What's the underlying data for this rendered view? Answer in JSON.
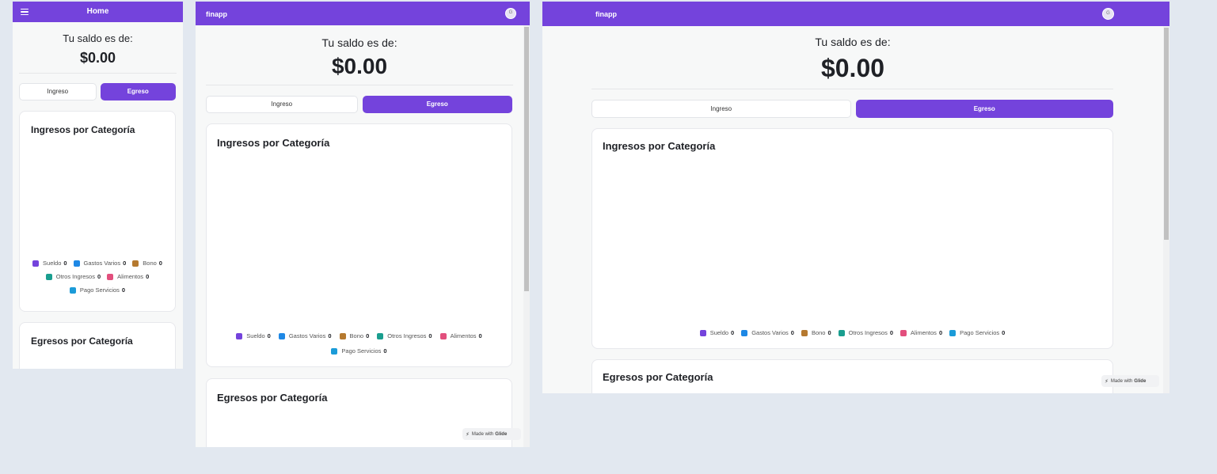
{
  "colors": {
    "accent": "#7443dc",
    "legend": [
      "#7443dc",
      "#1e88e5",
      "#b5792f",
      "#1a9e8f",
      "#e24f7d",
      "#1b9bd8"
    ]
  },
  "views": [
    {
      "header_title": "Home",
      "menu_icon": "hamburger-icon",
      "balance_label": "Tu saldo es de:",
      "balance_value": "$0.00",
      "segment": {
        "ingreso": "Ingreso",
        "egreso": "Egreso",
        "selected": "Egreso"
      },
      "card1_title": "Ingresos por Categoría",
      "card2_title": "Egresos por Categoría",
      "legend": [
        {
          "label": "Sueldo",
          "value": "0"
        },
        {
          "label": "Gastos Varios",
          "value": "0"
        },
        {
          "label": "Bono",
          "value": "0"
        },
        {
          "label": "Otros Ingresos",
          "value": "0"
        },
        {
          "label": "Alimentos",
          "value": "0"
        },
        {
          "label": "Pago Servicios",
          "value": "0"
        }
      ]
    },
    {
      "header_title": "finapp",
      "avatar_initial": "G",
      "balance_label": "Tu saldo es de:",
      "balance_value": "$0.00",
      "segment": {
        "ingreso": "Ingreso",
        "egreso": "Egreso",
        "selected": "Egreso"
      },
      "card1_title": "Ingresos por Categoría",
      "card2_title": "Egresos por Categoría",
      "legend": [
        {
          "label": "Sueldo",
          "value": "0"
        },
        {
          "label": "Gastos Varios",
          "value": "0"
        },
        {
          "label": "Bono",
          "value": "0"
        },
        {
          "label": "Otros Ingresos",
          "value": "0"
        },
        {
          "label": "Alimentos",
          "value": "0"
        },
        {
          "label": "Pago Servicios",
          "value": "0"
        }
      ],
      "badge": {
        "prefix": "Made with",
        "brand": "Glide"
      }
    },
    {
      "header_title": "finapp",
      "avatar_initial": "G",
      "balance_label": "Tu saldo es de:",
      "balance_value": "$0.00",
      "segment": {
        "ingreso": "Ingreso",
        "egreso": "Egreso",
        "selected": "Egreso"
      },
      "card1_title": "Ingresos por Categoría",
      "card2_title": "Egresos por Categoría",
      "legend": [
        {
          "label": "Sueldo",
          "value": "0"
        },
        {
          "label": "Gastos Varios",
          "value": "0"
        },
        {
          "label": "Bono",
          "value": "0"
        },
        {
          "label": "Otros Ingresos",
          "value": "0"
        },
        {
          "label": "Alimentos",
          "value": "0"
        },
        {
          "label": "Pago Servicios",
          "value": "0"
        }
      ],
      "badge": {
        "prefix": "Made with",
        "brand": "Glide"
      }
    }
  ]
}
